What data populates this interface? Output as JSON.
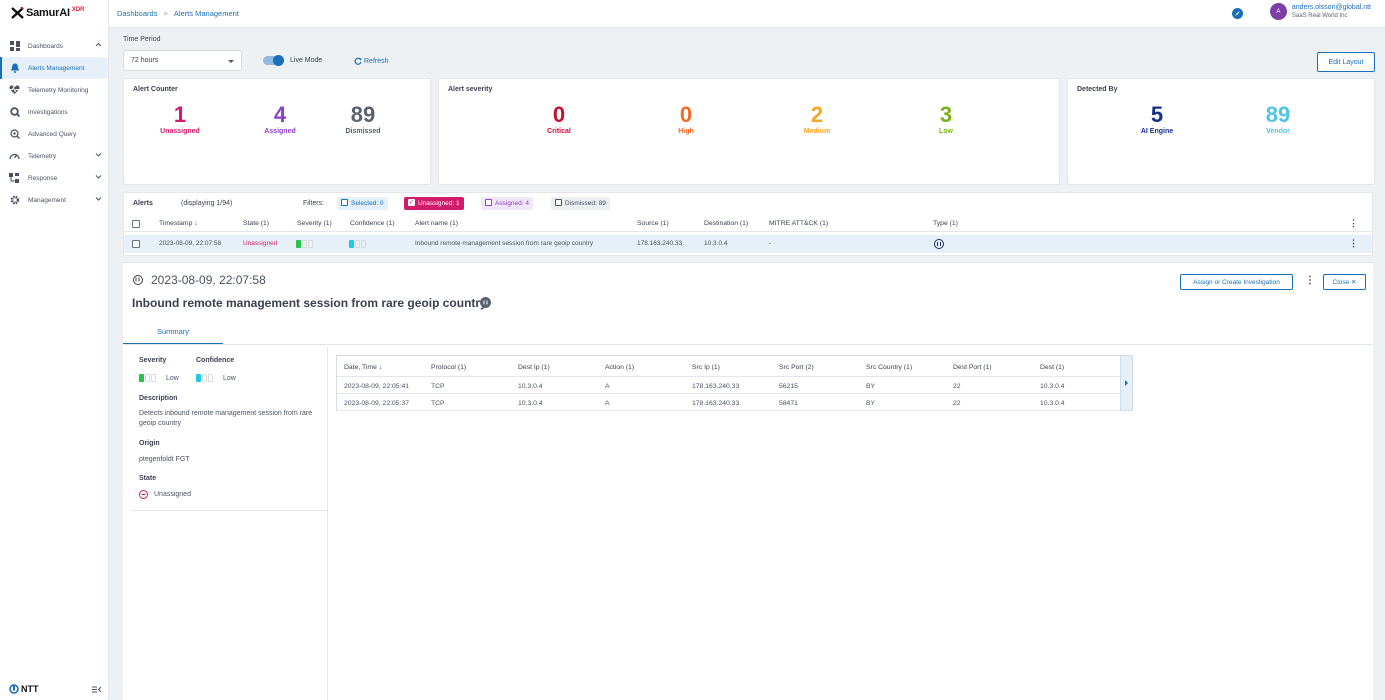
{
  "brand": {
    "name": "SamurAI",
    "suffix": "XDR",
    "footer": "NTT"
  },
  "sidebar": {
    "items": [
      {
        "label": "Dashboards",
        "icon": "grid-icon",
        "chevron": "up"
      },
      {
        "label": "Alerts Management",
        "icon": "bell-icon",
        "active": true
      },
      {
        "label": "Telemetry Monitoring",
        "icon": "heartbeat-icon"
      },
      {
        "label": "Investigations",
        "icon": "magnifier-icon"
      },
      {
        "label": "Advanced Query",
        "icon": "query-icon"
      },
      {
        "label": "Telemetry",
        "icon": "gauge-icon",
        "chevron": "down"
      },
      {
        "label": "Response",
        "icon": "response-icon",
        "chevron": "down"
      },
      {
        "label": "Management",
        "icon": "gear-icon",
        "chevron": "down"
      }
    ]
  },
  "topbar": {
    "breadcrumb": [
      "Dashboards",
      "Alerts Management"
    ],
    "user": {
      "initial": "A",
      "email": "anders.olsson@global.ntt",
      "org": "SaaS Real World Inc"
    }
  },
  "controls": {
    "time_period_label": "Time Period",
    "time_period_value": "72 hours",
    "live_mode_label": "Live Mode",
    "refresh_label": "Refresh",
    "edit_layout_label": "Edit Layout"
  },
  "cards": {
    "alert_counter": {
      "title": "Alert Counter",
      "stats": [
        {
          "value": "1",
          "label": "Unassigned",
          "color": "#d01c6b"
        },
        {
          "value": "4",
          "label": "Assigned",
          "color": "#8d3fcc"
        },
        {
          "value": "89",
          "label": "Dismissed",
          "color": "#5a6270"
        }
      ]
    },
    "alert_severity": {
      "title": "Alert severity",
      "stats": [
        {
          "value": "0",
          "label": "Critical",
          "color": "#c8102e"
        },
        {
          "value": "0",
          "label": "High",
          "color": "#f26b21"
        },
        {
          "value": "2",
          "label": "Medium",
          "color": "#f5a623"
        },
        {
          "value": "3",
          "label": "Low",
          "color": "#7ab317"
        }
      ]
    },
    "detected_by": {
      "title": "Detected By",
      "stats": [
        {
          "value": "5",
          "label": "AI Engine",
          "color": "#13308f"
        },
        {
          "value": "89",
          "label": "Vendor",
          "color": "#4fc3e8"
        }
      ]
    }
  },
  "alerts": {
    "title": "Alerts",
    "displaying": "(displaying 1/94)",
    "filters_label": "Filters:",
    "filters": {
      "selected": "Selected: 0",
      "unassigned": "Unassigned: 1",
      "assigned": "Assigned: 4",
      "dismissed": "Dismissed: 89"
    },
    "columns": [
      "Timestamp",
      "State (1)",
      "Severity (1)",
      "Confidence (1)",
      "Alert name (1)",
      "Source (1)",
      "Destination (1)",
      "MITRE ATT&CK (1)",
      "Type (1)"
    ],
    "row": {
      "timestamp": "2023-08-09, 22:07:58",
      "state": "Unassigned",
      "severity_level": 1,
      "confidence_level": 1,
      "alert_name": "Inbound remote management session from rare geoip country",
      "source": "178.163.240.33",
      "destination": "10.3.0.4",
      "mitre": "-"
    }
  },
  "detail": {
    "timestamp": "2023-08-09, 22:07:58",
    "title": "Inbound remote management session from rare geoip country",
    "assign_label": "Assign or Create Investigation",
    "close_label": "Close",
    "tab_summary": "Summary",
    "severity_label": "Severity",
    "severity_value": "Low",
    "confidence_label": "Confidence",
    "confidence_value": "Low",
    "description_label": "Description",
    "description": "Detects inbound remote management session from rare geoip country",
    "origin_label": "Origin",
    "origin": "ptegenfoldt FGT",
    "state_label": "State",
    "state": "Unassigned"
  },
  "events": {
    "columns": [
      "Date, Time",
      "Protocol (1)",
      "Dest Ip (1)",
      "Action (1)",
      "Src Ip (1)",
      "Src Port (2)",
      "Src Country (1)",
      "Dest Port (1)",
      "Dest (1)"
    ],
    "rows": [
      [
        "2023-08-09, 22:05:41",
        "TCP",
        "10.3.0.4",
        "A",
        "178.163.240.33",
        "56215",
        "BY",
        "22",
        "10.3.0.4"
      ],
      [
        "2023-08-09, 22:05:37",
        "TCP",
        "10.3.0.4",
        "A",
        "178.163.240.33",
        "58471",
        "BY",
        "22",
        "10.3.0.4"
      ]
    ]
  }
}
